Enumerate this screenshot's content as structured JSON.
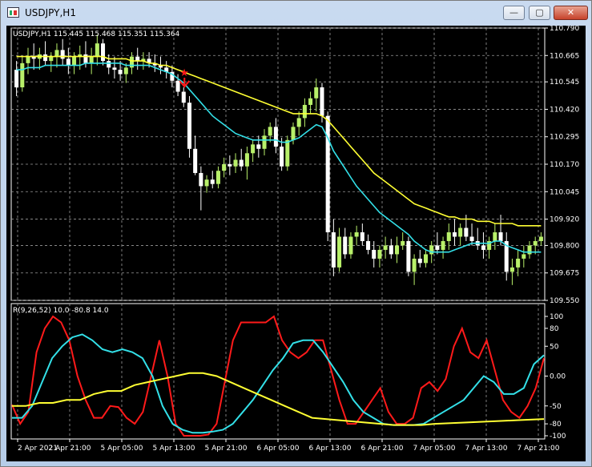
{
  "window": {
    "title": "USDJPY,H1",
    "controls": {
      "minimize": "—",
      "maximize": "▢",
      "close": "✕"
    }
  },
  "colors": {
    "background": "#000000",
    "grid": "#9a9a9a",
    "bull_candle": "#b8f06a",
    "bear_candle": "#ffffff",
    "ma_fast": "#33e0e8",
    "ma_slow": "#ffff33",
    "rsi_main": "#ff1a1a",
    "rsi_signal": "#33e0e8",
    "rsi_slow": "#ffff33",
    "signal_marker": "#ff1a1a"
  },
  "main_panel": {
    "header": "USDJPY,H1  115.445 115.468 115.351 115.364"
  },
  "indicator_panel": {
    "header": "R(9,26,52) 10.0 -80.8 14.0"
  },
  "chart_data": [
    {
      "type": "candlestick",
      "title": "USDJPY,H1",
      "y_ticks": [
        "110.790",
        "110.665",
        "110.545",
        "110.420",
        "110.295",
        "110.170",
        "110.045",
        "109.920",
        "109.800",
        "109.675",
        "109.550"
      ],
      "ylim": [
        109.55,
        110.79
      ],
      "x_ticks": [
        "2 Apr 2021",
        "2 Apr 21:00",
        "5 Apr 05:00",
        "5 Apr 13:00",
        "5 Apr 21:00",
        "6 Apr 05:00",
        "6 Apr 13:00",
        "6 Apr 21:00",
        "7 Apr 05:00",
        "7 Apr 13:00",
        "7 Apr 21:00"
      ],
      "grid": true,
      "ohlc": [
        [
          110.6,
          110.64,
          110.48,
          110.52
        ],
        [
          110.52,
          110.66,
          110.5,
          110.63
        ],
        [
          110.63,
          110.7,
          110.58,
          110.66
        ],
        [
          110.66,
          110.72,
          110.6,
          110.65
        ],
        [
          110.65,
          110.7,
          110.6,
          110.67
        ],
        [
          110.67,
          110.73,
          110.62,
          110.64
        ],
        [
          110.64,
          110.68,
          110.59,
          110.66
        ],
        [
          110.66,
          110.72,
          110.61,
          110.69
        ],
        [
          110.69,
          110.74,
          110.62,
          110.65
        ],
        [
          110.65,
          110.7,
          110.58,
          110.62
        ],
        [
          110.62,
          110.68,
          110.58,
          110.66
        ],
        [
          110.66,
          110.71,
          110.6,
          110.67
        ],
        [
          110.67,
          110.73,
          110.61,
          110.63
        ],
        [
          110.63,
          110.7,
          110.58,
          110.66
        ],
        [
          110.66,
          110.76,
          110.62,
          110.72
        ],
        [
          110.72,
          110.74,
          110.62,
          110.64
        ],
        [
          110.64,
          110.67,
          110.58,
          110.61
        ],
        [
          110.61,
          110.66,
          110.56,
          110.6
        ],
        [
          110.6,
          110.64,
          110.55,
          110.58
        ],
        [
          110.58,
          110.63,
          110.54,
          110.61
        ],
        [
          110.61,
          110.68,
          110.58,
          110.66
        ],
        [
          110.66,
          110.7,
          110.6,
          110.64
        ],
        [
          110.64,
          110.68,
          110.6,
          110.65
        ],
        [
          110.65,
          110.68,
          110.61,
          110.63
        ],
        [
          110.63,
          110.67,
          110.59,
          110.62
        ],
        [
          110.62,
          110.66,
          110.58,
          110.61
        ],
        [
          110.61,
          110.64,
          110.56,
          110.59
        ],
        [
          110.59,
          110.62,
          110.52,
          110.55
        ],
        [
          110.55,
          110.58,
          110.48,
          110.5
        ],
        [
          110.5,
          110.52,
          110.43,
          110.45
        ],
        [
          110.45,
          110.48,
          110.2,
          110.24
        ],
        [
          110.24,
          110.3,
          110.12,
          110.13
        ],
        [
          110.13,
          110.16,
          109.96,
          110.07
        ],
        [
          110.07,
          110.12,
          110.04,
          110.1
        ],
        [
          110.1,
          110.14,
          110.06,
          110.08
        ],
        [
          110.08,
          110.16,
          110.06,
          110.14
        ],
        [
          110.14,
          110.2,
          110.11,
          110.17
        ],
        [
          110.17,
          110.21,
          110.12,
          110.16
        ],
        [
          110.16,
          110.22,
          110.13,
          110.19
        ],
        [
          110.19,
          110.24,
          110.14,
          110.16
        ],
        [
          110.16,
          110.25,
          110.1,
          110.22
        ],
        [
          110.22,
          110.28,
          110.18,
          110.26
        ],
        [
          110.26,
          110.3,
          110.2,
          110.24
        ],
        [
          110.24,
          110.33,
          110.21,
          110.3
        ],
        [
          110.3,
          110.36,
          110.27,
          110.34
        ],
        [
          110.34,
          110.38,
          110.22,
          110.25
        ],
        [
          110.25,
          110.29,
          110.14,
          110.16
        ],
        [
          110.16,
          110.3,
          110.14,
          110.28
        ],
        [
          110.28,
          110.36,
          110.26,
          110.34
        ],
        [
          110.34,
          110.41,
          110.3,
          110.38
        ],
        [
          110.38,
          110.47,
          110.34,
          110.44
        ],
        [
          110.44,
          110.5,
          110.4,
          110.47
        ],
        [
          110.47,
          110.56,
          110.41,
          110.52
        ],
        [
          110.52,
          110.54,
          110.36,
          110.39
        ],
        [
          110.39,
          110.41,
          109.82,
          109.86
        ],
        [
          109.86,
          109.92,
          109.66,
          109.7
        ],
        [
          109.7,
          109.88,
          109.68,
          109.84
        ],
        [
          109.84,
          109.88,
          109.74,
          109.76
        ],
        [
          109.76,
          109.86,
          109.74,
          109.84
        ],
        [
          109.84,
          109.89,
          109.8,
          109.86
        ],
        [
          109.86,
          109.9,
          109.8,
          109.82
        ],
        [
          109.82,
          109.85,
          109.76,
          109.78
        ],
        [
          109.78,
          109.82,
          109.7,
          109.74
        ],
        [
          109.74,
          109.8,
          109.7,
          109.78
        ],
        [
          109.78,
          109.84,
          109.74,
          109.8
        ],
        [
          109.8,
          109.83,
          109.74,
          109.76
        ],
        [
          109.76,
          109.84,
          109.72,
          109.8
        ],
        [
          109.8,
          109.86,
          109.78,
          109.82
        ],
        [
          109.82,
          109.84,
          109.66,
          109.68
        ],
        [
          109.68,
          109.76,
          109.62,
          109.74
        ],
        [
          109.74,
          109.78,
          109.7,
          109.72
        ],
        [
          109.72,
          109.78,
          109.7,
          109.76
        ],
        [
          109.76,
          109.82,
          109.72,
          109.8
        ],
        [
          109.8,
          109.86,
          109.76,
          109.78
        ],
        [
          109.78,
          109.84,
          109.74,
          109.82
        ],
        [
          109.82,
          109.9,
          109.78,
          109.86
        ],
        [
          109.86,
          109.92,
          109.8,
          109.84
        ],
        [
          109.84,
          109.9,
          109.8,
          109.88
        ],
        [
          109.88,
          109.94,
          109.82,
          109.84
        ],
        [
          109.84,
          109.9,
          109.8,
          109.82
        ],
        [
          109.82,
          109.88,
          109.78,
          109.8
        ],
        [
          109.8,
          109.86,
          109.74,
          109.78
        ],
        [
          109.78,
          109.84,
          109.74,
          109.82
        ],
        [
          109.82,
          109.9,
          109.78,
          109.86
        ],
        [
          109.86,
          109.94,
          109.8,
          109.82
        ],
        [
          109.82,
          109.86,
          109.64,
          109.68
        ],
        [
          109.68,
          109.74,
          109.62,
          109.7
        ],
        [
          109.7,
          109.78,
          109.66,
          109.74
        ],
        [
          109.74,
          109.8,
          109.7,
          109.76
        ],
        [
          109.76,
          109.82,
          109.74,
          109.8
        ],
        [
          109.8,
          109.84,
          109.76,
          109.82
        ],
        [
          109.82,
          109.86,
          109.8,
          109.84
        ]
      ],
      "ma_fast": [
        110.6,
        110.6,
        110.61,
        110.61,
        110.61,
        110.62,
        110.62,
        110.62,
        110.62,
        110.62,
        110.62,
        110.62,
        110.63,
        110.63,
        110.63,
        110.63,
        110.63,
        110.63,
        110.63,
        110.62,
        110.62,
        110.62,
        110.62,
        110.62,
        110.61,
        110.6,
        110.59,
        110.58,
        110.56,
        110.54,
        110.51,
        110.48,
        110.45,
        110.42,
        110.39,
        110.37,
        110.35,
        110.33,
        110.31,
        110.3,
        110.29,
        110.28,
        110.28,
        110.28,
        110.28,
        110.28,
        110.27,
        110.27,
        110.28,
        110.29,
        110.31,
        110.33,
        110.35,
        110.34,
        110.29,
        110.23,
        110.19,
        110.15,
        110.11,
        110.07,
        110.04,
        110.01,
        109.98,
        109.95,
        109.93,
        109.91,
        109.89,
        109.87,
        109.85,
        109.82,
        109.8,
        109.78,
        109.77,
        109.77,
        109.77,
        109.77,
        109.78,
        109.79,
        109.8,
        109.81,
        109.81,
        109.81,
        109.81,
        109.82,
        109.82,
        109.8,
        109.79,
        109.78,
        109.77,
        109.77,
        109.77,
        109.77
      ],
      "ma_slow": [
        110.66,
        110.66,
        110.66,
        110.66,
        110.66,
        110.66,
        110.66,
        110.66,
        110.66,
        110.66,
        110.66,
        110.66,
        110.66,
        110.66,
        110.66,
        110.66,
        110.65,
        110.65,
        110.65,
        110.65,
        110.64,
        110.64,
        110.64,
        110.63,
        110.63,
        110.62,
        110.62,
        110.61,
        110.6,
        110.59,
        110.58,
        110.57,
        110.56,
        110.55,
        110.54,
        110.53,
        110.52,
        110.51,
        110.5,
        110.49,
        110.48,
        110.47,
        110.46,
        110.45,
        110.44,
        110.43,
        110.42,
        110.41,
        110.4,
        110.4,
        110.4,
        110.4,
        110.4,
        110.39,
        110.37,
        110.34,
        110.31,
        110.28,
        110.25,
        110.22,
        110.19,
        110.16,
        110.13,
        110.11,
        110.09,
        110.07,
        110.05,
        110.03,
        110.01,
        109.99,
        109.98,
        109.97,
        109.96,
        109.95,
        109.94,
        109.93,
        109.93,
        109.92,
        109.92,
        109.92,
        109.91,
        109.91,
        109.91,
        109.9,
        109.9,
        109.9,
        109.9,
        109.89,
        109.89,
        109.89,
        109.89,
        109.89
      ],
      "markers": [
        {
          "type": "sell-arrow",
          "index": 29
        }
      ]
    },
    {
      "type": "line",
      "title": "R(9,26,52)",
      "y_ticks": [
        "100",
        "80",
        "50",
        "0.00",
        "-50",
        "-80",
        "-100"
      ],
      "ylim": [
        -100,
        100
      ],
      "levels": [
        10.0,
        -80.8,
        14.0
      ],
      "series": [
        {
          "name": "R(9)",
          "color": "#ff1a1a",
          "values": [
            -48,
            -80,
            -60,
            40,
            80,
            100,
            90,
            60,
            0,
            -40,
            -70,
            -70,
            -50,
            -52,
            -70,
            -80,
            -60,
            0,
            60,
            0,
            -80,
            -100,
            -100,
            -100,
            -98,
            -80,
            -10,
            60,
            90,
            90,
            90,
            90,
            100,
            60,
            40,
            30,
            40,
            60,
            60,
            10,
            -40,
            -80,
            -80,
            -60,
            -40,
            -20,
            -60,
            -80,
            -80,
            -70,
            -20,
            -10,
            -25,
            -5,
            50,
            80,
            40,
            30,
            60,
            10,
            -40,
            -60,
            -70,
            -50,
            -20,
            30
          ]
        },
        {
          "name": "R(26)",
          "color": "#33e0e8",
          "values": [
            -70,
            -70,
            -50,
            -10,
            30,
            50,
            65,
            70,
            60,
            45,
            40,
            45,
            40,
            30,
            0,
            -50,
            -80,
            -90,
            -95,
            -95,
            -93,
            -90,
            -80,
            -60,
            -40,
            -15,
            10,
            30,
            55,
            60,
            60,
            40,
            15,
            -10,
            -40,
            -60,
            -70,
            -80,
            -82,
            -82,
            -82,
            -80,
            -70,
            -60,
            -50,
            -40,
            -20,
            0,
            -10,
            -30,
            -30,
            -20,
            20,
            35
          ]
        },
        {
          "name": "R(52)",
          "color": "#ffff33",
          "values": [
            -50,
            -50,
            -45,
            -45,
            -40,
            -40,
            -30,
            -25,
            -25,
            -15,
            -10,
            -5,
            0,
            5,
            5,
            0,
            -10,
            -20,
            -30,
            -40,
            -50,
            -60,
            -70,
            -72,
            -74,
            -76,
            -78,
            -80,
            -82,
            -82,
            -82,
            -80,
            -79,
            -78,
            -77,
            -76,
            -75,
            -74,
            -73,
            -72
          ]
        }
      ]
    }
  ]
}
